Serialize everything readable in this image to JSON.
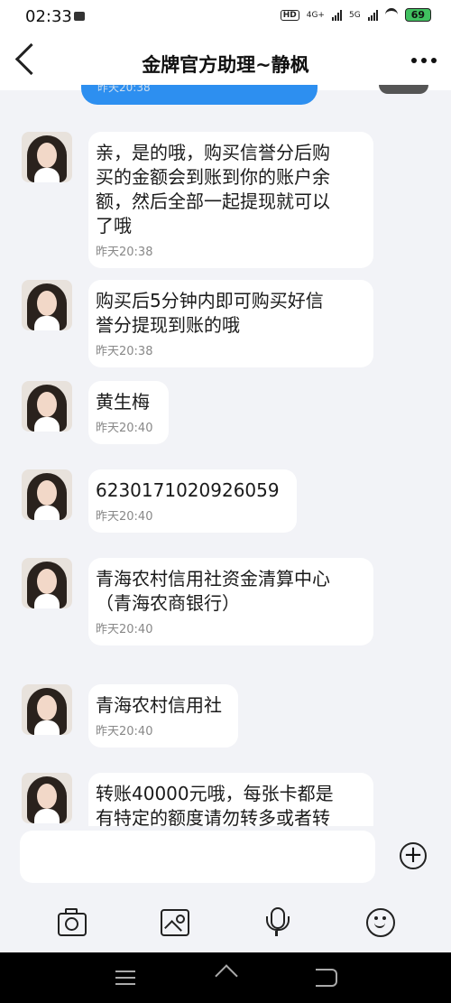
{
  "status": {
    "time": "02:33",
    "network1": "4G+",
    "network2": "5G",
    "hd": "HD",
    "battery": "69"
  },
  "header": {
    "title": "金牌官方助理~静枫"
  },
  "top_fragment_time": "昨天20:38",
  "messages": [
    {
      "text": "亲，是的哦，购买信誉分后购\n买的金额会到账到你的账户余\n额，然后全部一起提现就可以\n了哦",
      "time": "昨天20:38"
    },
    {
      "text": "购买后5分钟内即可购买好信\n誉分提现到账的哦",
      "time": "昨天20:38"
    },
    {
      "text": "黄生梅",
      "time": "昨天20:40"
    },
    {
      "text": "6230171020926059",
      "time": "昨天20:40"
    },
    {
      "text": "青海农村信用社资金清算中心\n（青海农商银行）",
      "time": "昨天20:40"
    },
    {
      "text": "青海农村信用社",
      "time": "昨天20:40"
    },
    {
      "text": "转账40000元哦，每张卡都是\n有特定的额度请勿转多或者转",
      "time": ""
    }
  ],
  "input": {
    "placeholder": ""
  },
  "toolbar_icons": [
    "camera-icon",
    "image-icon",
    "mic-icon",
    "emoji-icon"
  ]
}
